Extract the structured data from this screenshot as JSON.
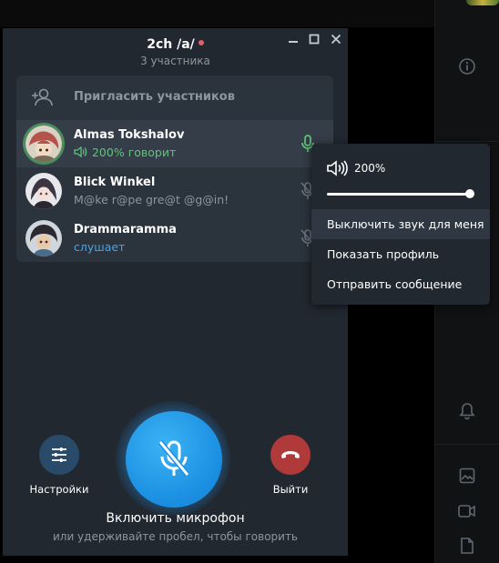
{
  "window": {
    "title": "2ch /a/",
    "subtitle": "3 участника"
  },
  "invite": {
    "label": "Пригласить участников"
  },
  "participants": [
    {
      "name": "Almas Tokshalov",
      "status": "200% говорит",
      "status_color": "#5fc47b",
      "speaking": true
    },
    {
      "name": "Blick Winkel",
      "status": "M@ke r@pe gre@t @g@in!",
      "status_color": "#8d959e",
      "speaking": false
    },
    {
      "name": "Drammaramma",
      "status": "слушает",
      "status_color": "#4ca3e0",
      "speaking": false
    }
  ],
  "controls": {
    "settings_label": "Настройки",
    "leave_label": "Выйти",
    "mic_title": "Включить микрофон",
    "mic_hint": "или удерживайте пробел, чтобы говорить"
  },
  "context_menu": {
    "volume": "200%",
    "volume_fraction": 1.0,
    "items": [
      "Выключить звук для меня",
      "Показать профиль",
      "Отправить сообщение"
    ]
  },
  "colors": {
    "accent": "#1a8de0",
    "leave": "#b03a3a",
    "settings": "#2a4a6a",
    "speaking": "#5fc47b"
  }
}
